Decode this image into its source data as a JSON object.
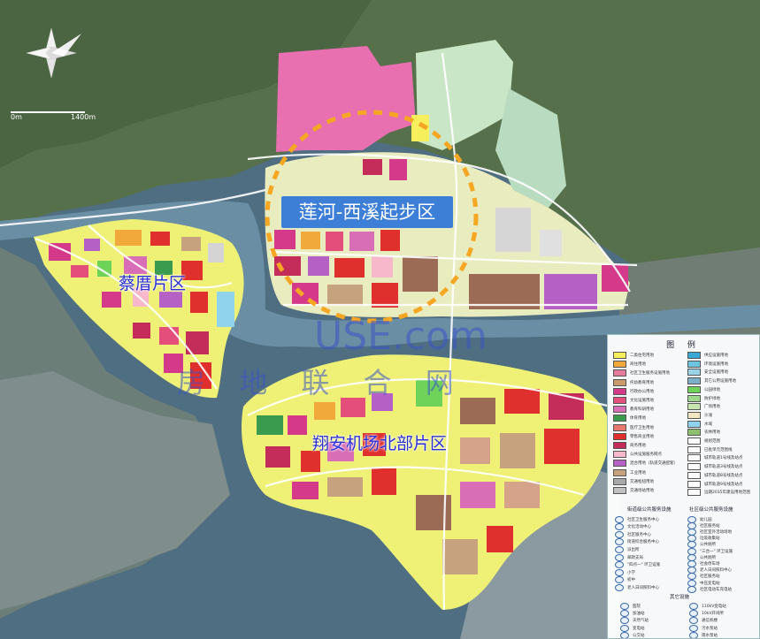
{
  "labels": {
    "startup_zone": "莲河-西溪起步区",
    "caiqiao": "蔡厝片区",
    "xiangan_north": "翔安机场北部片区"
  },
  "scale": {
    "zero": "0m",
    "max": "1400m"
  },
  "watermark": {
    "brand": "USE.com",
    "cn": "房 地 联 合 网"
  },
  "legend": {
    "title": "图 例",
    "left_items": [
      {
        "label": "二类住宅用地",
        "color": "#f4ef5a"
      },
      {
        "label": "商住用地",
        "color": "#f2a93b"
      },
      {
        "label": "社区卫生服务设施用地",
        "color": "#e57c9c"
      },
      {
        "label": "托幼教育用地",
        "color": "#c99a6a"
      },
      {
        "label": "行政办公用地",
        "color": "#d4398a"
      },
      {
        "label": "文化设施用地",
        "color": "#e34e7a"
      },
      {
        "label": "教育科研用地",
        "color": "#d86fb6"
      },
      {
        "label": "体育用地",
        "color": "#3a9b4f"
      },
      {
        "label": "医疗卫生用地",
        "color": "#e8776e"
      },
      {
        "label": "零售商业用地",
        "color": "#e0302d"
      },
      {
        "label": "商务用地",
        "color": "#c42c5a"
      },
      {
        "label": "公共设施服务网点",
        "color": "#f7b8cc"
      },
      {
        "label": "混合用地（轨道交通配套）",
        "color": "#b560c4"
      },
      {
        "label": "工业用地",
        "color": "#c7a27e"
      },
      {
        "label": "交通枢纽用地",
        "color": "#a8a8a8"
      },
      {
        "label": "交通场站用地",
        "color": "#c0c0c0"
      }
    ],
    "right_items": [
      {
        "label": "供应设施用地",
        "color": "#39a7d6"
      },
      {
        "label": "环境设施用地",
        "color": "#6fc4e0"
      },
      {
        "label": "安全设施用地",
        "color": "#9bd3e8"
      },
      {
        "label": "其它公用设施用地",
        "color": "#7db0c8"
      },
      {
        "label": "公园绿地",
        "color": "#6fd35a"
      },
      {
        "label": "防护绿地",
        "color": "#9cd98b"
      },
      {
        "label": "广场用地",
        "color": "#c6e8b0"
      },
      {
        "label": "沙滩",
        "color": "#f0e6c0"
      },
      {
        "label": "水域",
        "color": "#8fd4ec"
      },
      {
        "label": "农林用地",
        "color": "#8dbf6e"
      },
      {
        "label": "规划范围",
        "color": "#ffffff"
      },
      {
        "label": "已批单元范围线",
        "color": "#ffffff"
      },
      {
        "label": "城市轨道1号线及站点",
        "color": "#ffffff"
      },
      {
        "label": "城市轨道3号线及站点",
        "color": "#ffffff"
      },
      {
        "label": "城市轨道8号线及站点",
        "color": "#ffffff"
      },
      {
        "label": "城市轨道9号线及站点",
        "color": "#ffffff"
      },
      {
        "label": "远期2035年建设用地范围",
        "color": "#ffffff"
      }
    ],
    "section_street": "街道级公共服务设施",
    "section_community": "社区级公共服务设施",
    "section_other": "其它设施",
    "street_items": [
      "社区卫生服务中心",
      "文化活动中心",
      "社区服务中心",
      "街道综合服务中心",
      "派出所",
      "邮政支局",
      "\"四点一\" 环卫设施",
      "小学",
      "初中",
      "老人日间照料中心"
    ],
    "community_items": [
      "幼儿园",
      "社区服务站",
      "社区室外活动场地",
      "垃圾收集站",
      "公共厕所",
      "\"三合一\" 环卫设施",
      "公共厕所",
      "社会停车场",
      "老人日间照料中心",
      "社区服务站",
      "中压变电站",
      "社区电动车充电站"
    ],
    "other_items_left": [
      "医院",
      "加油站",
      "天然气站",
      "变电站",
      "公交站"
    ],
    "other_items_right": [
      "110kV变电站",
      "10kV开闭所",
      "通信机楼",
      "污水泵站",
      "雨水泵站"
    ]
  }
}
